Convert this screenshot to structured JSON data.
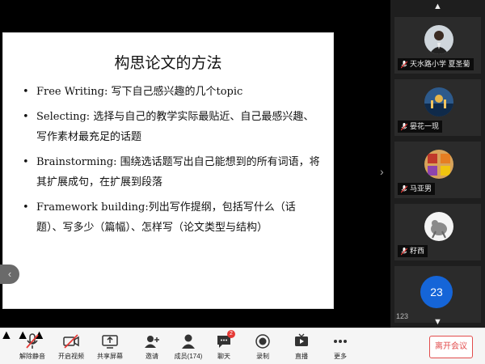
{
  "slide": {
    "title": "构思论文的方法",
    "bullets": [
      "Free Writing: 写下自己感兴趣的几个topic",
      "Selecting: 选择与自己的教学实际最贴近、自己最感兴趣、写作素材最充足的话题",
      "Brainstorming: 围绕选话题写出自己能想到的所有词语，将其扩展成句，在扩展到段落",
      "Framework building:列出写作提纲，包括写什么（话题）、写多少（篇幅）、怎样写（论文类型与结构）"
    ]
  },
  "participants": [
    {
      "name": "天水路小学 夏圣菊"
    },
    {
      "name": "晏花一现"
    },
    {
      "name": "马亚男"
    },
    {
      "name": "籽西"
    }
  ],
  "overflow_count": "23",
  "page_indicator": "123",
  "toolbar": {
    "unmute": "解除静音",
    "start_video": "开启视频",
    "share_screen": "共享屏幕",
    "invite": "邀请",
    "members": "成员(174)",
    "chat": "聊天",
    "chat_badge": "2",
    "record": "录制",
    "live": "直播",
    "more": "更多",
    "leave": "离开会议"
  },
  "colors": {
    "accent_blue": "#1565d8",
    "leave_red": "#e24c4c",
    "muted_red": "#e53935"
  }
}
